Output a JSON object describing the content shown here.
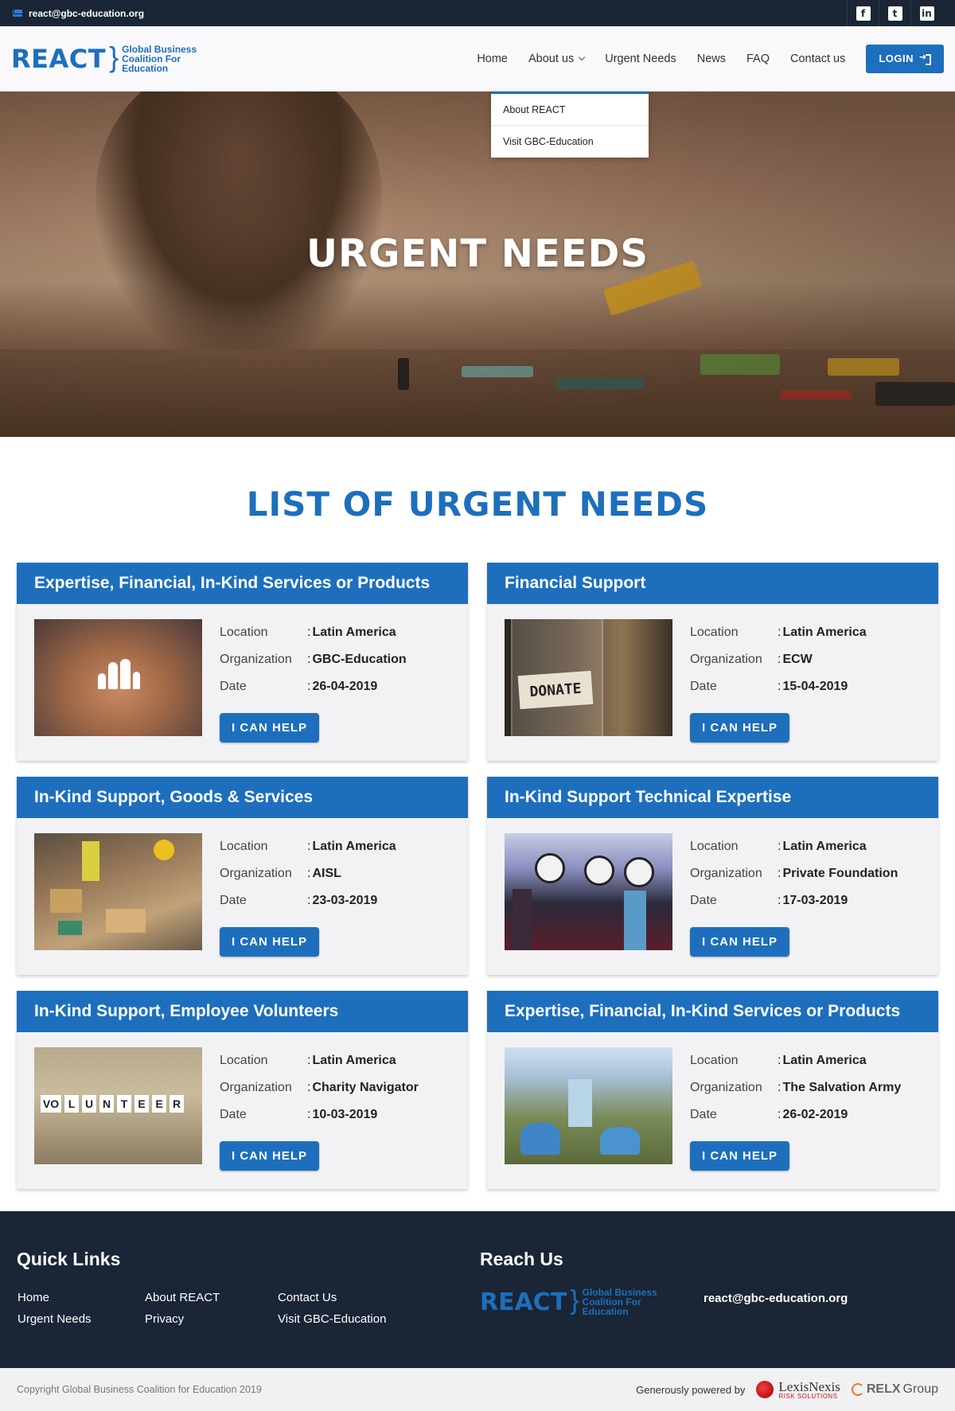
{
  "topbar": {
    "email": "react@gbc-education.org",
    "social_icons": [
      "facebook-icon",
      "twitter-icon",
      "linkedin-icon"
    ],
    "social_glyphs": [
      "f",
      "t",
      "in"
    ]
  },
  "header": {
    "logo": {
      "word": "REACT",
      "line1": "Global Business",
      "line2": "Coalition For",
      "line3": "Education"
    },
    "nav": {
      "home": "Home",
      "about": "About us",
      "urgent": "Urgent Needs",
      "news": "News",
      "faq": "FAQ",
      "contact": "Contact us"
    },
    "login_label": "LOGIN"
  },
  "dropdown": {
    "items": [
      "About REACT",
      "Visit GBC-Education"
    ]
  },
  "hero": {
    "title": "URGENT NEEDS"
  },
  "section": {
    "title": "LIST OF URGENT NEEDS"
  },
  "labels": {
    "location": "Location",
    "organization": "Organization",
    "date": "Date",
    "help": "I CAN HELP"
  },
  "needs": [
    {
      "title": "Expertise, Financial, In-Kind Services or Products",
      "location": "Latin America",
      "organization": "GBC-Education",
      "date": "26-04-2019"
    },
    {
      "title": "Financial Support",
      "location": "Latin America",
      "organization": "ECW",
      "date": "15-04-2019"
    },
    {
      "title": "In-Kind Support, Goods & Services",
      "location": "Latin America",
      "organization": "AISL",
      "date": "23-03-2019"
    },
    {
      "title": "In-Kind Support Technical Expertise",
      "location": "Latin America",
      "organization": "Private Foundation",
      "date": "17-03-2019"
    },
    {
      "title": "In-Kind Support, Employee Volunteers",
      "location": "Latin America",
      "organization": "Charity Navigator",
      "date": "10-03-2019"
    },
    {
      "title": "Expertise, Financial, In-Kind Services or Products",
      "location": "Latin America",
      "organization": "The Salvation Army",
      "date": "26-02-2019"
    }
  ],
  "thumb_text": {
    "donate": "DONATE",
    "volunteer": [
      "VO",
      "L",
      "U",
      "N",
      "T",
      "E",
      "E",
      "R"
    ]
  },
  "footer": {
    "quick_links_title": "Quick Links",
    "reach_us_title": "Reach Us",
    "links": {
      "home": "Home",
      "urgent": "Urgent Needs",
      "about": "About REACT",
      "privacy": "Privacy",
      "contact": "Contact Us",
      "visit": "Visit GBC-Education"
    },
    "email": "react@gbc-education.org",
    "copyright": "Copyright Global Business Coalition for Education 2019",
    "powered_by": "Generously powered by",
    "lexis": "LexisNexis",
    "lexis_sub": "RISK SOLUTIONS",
    "relx": "RELX",
    "relx_group": "Group"
  },
  "colors": {
    "primary": "#1d6fbd",
    "dark": "#1a2535",
    "card_bg": "#f2f2f4"
  }
}
